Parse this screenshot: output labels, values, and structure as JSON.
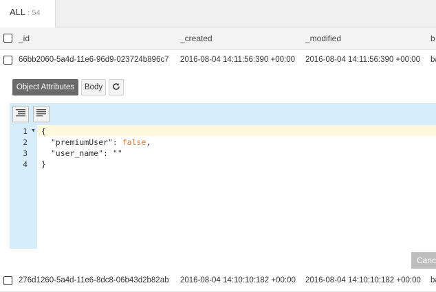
{
  "tab": {
    "label": "ALL",
    "count": ": 54"
  },
  "columns": [
    "_id",
    "_created",
    "_modified",
    "b"
  ],
  "rows": [
    {
      "id": "66bb2060-5a4d-11e6-96d9-023724b896c7",
      "created": "2016-08-04 14:11:56:390 +00:00",
      "modified": "2016-08-04 14:11:56:390 +00:00",
      "extra": "ba"
    },
    {
      "id": "276d1260-5a4d-11e6-8dc8-06b43d2b82ab",
      "created": "2016-08-04 14:10:10:182 +00:00",
      "modified": "2016-08-04 14:10:10:182 +00:00",
      "extra": "ba"
    }
  ],
  "detail": {
    "tabs": {
      "object_attributes": "Object Attributes",
      "body": "Body"
    },
    "refresh_icon": "refresh-icon",
    "toolbar_icons": [
      "format-indent-icon",
      "format-compact-icon"
    ],
    "line_numbers": [
      "1",
      "2",
      "3",
      "4"
    ],
    "code": {
      "open_brace": "{",
      "key1": "\"premiumUser\"",
      "colon": ": ",
      "val1": "false",
      "comma": ",",
      "key2": "\"user_name\"",
      "val2": "\"\"",
      "close_brace": "}"
    },
    "cancel_label": "Canc"
  },
  "colors": {
    "accent": "#d5ecfb",
    "keyword": "#e07b39",
    "dark_button": "#6a6a6a"
  }
}
